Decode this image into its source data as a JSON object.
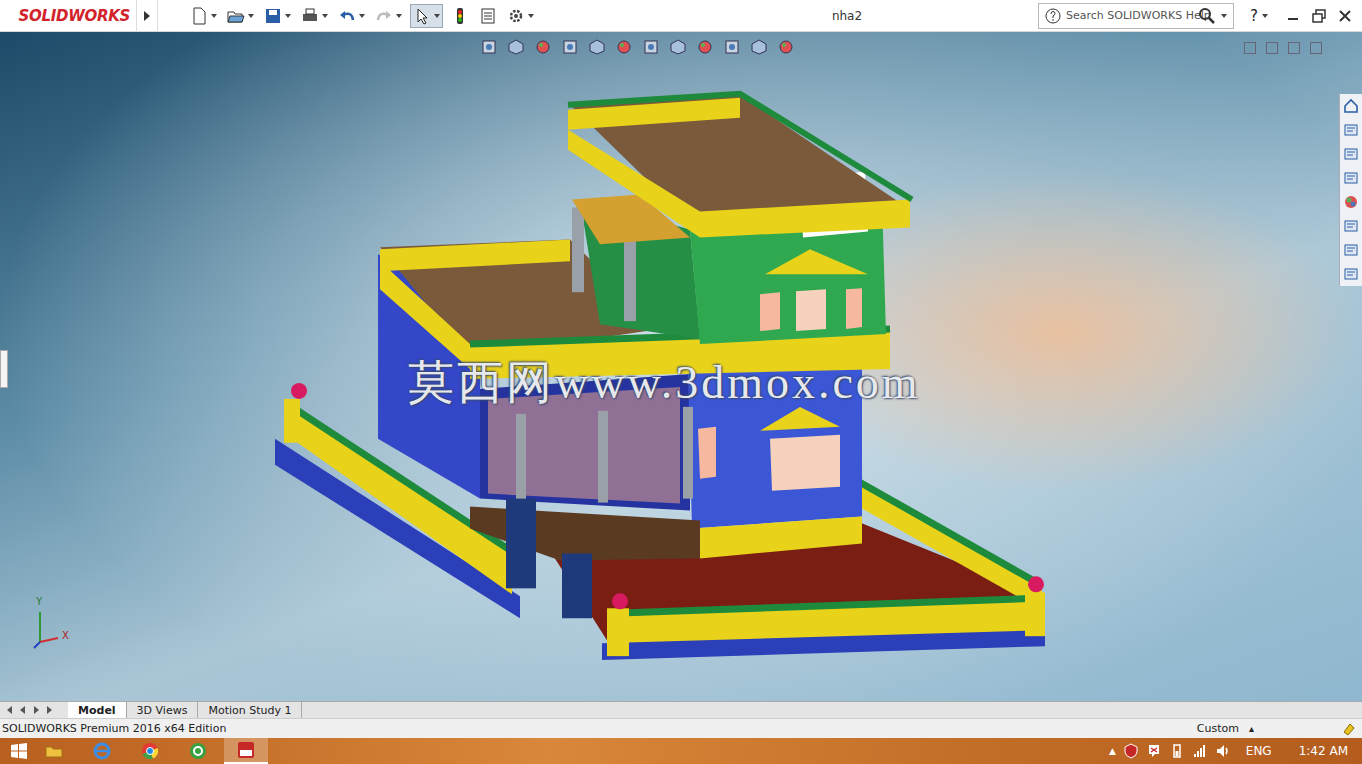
{
  "app": {
    "logo": "SOLIDWORKS",
    "title": "nha2",
    "search": {
      "placeholder": "Search SOLIDWORKS Help"
    },
    "help": "?"
  },
  "viewport": {
    "watermark": "莫西网www.3dmox.com",
    "triad": {
      "y": "Y",
      "x": "X"
    }
  },
  "tabs": [
    {
      "label": "Model",
      "selected": true
    },
    {
      "label": "3D Views",
      "selected": false
    },
    {
      "label": "Motion Study 1",
      "selected": false
    }
  ],
  "status_bar": {
    "edition": "SOLIDWORKS Premium 2016 x64 Edition",
    "units": "Custom",
    "units_arrow": "▴"
  },
  "taskbar": {
    "tray_arrow": "▲",
    "language": "ENG",
    "time": "1:42 AM"
  }
}
